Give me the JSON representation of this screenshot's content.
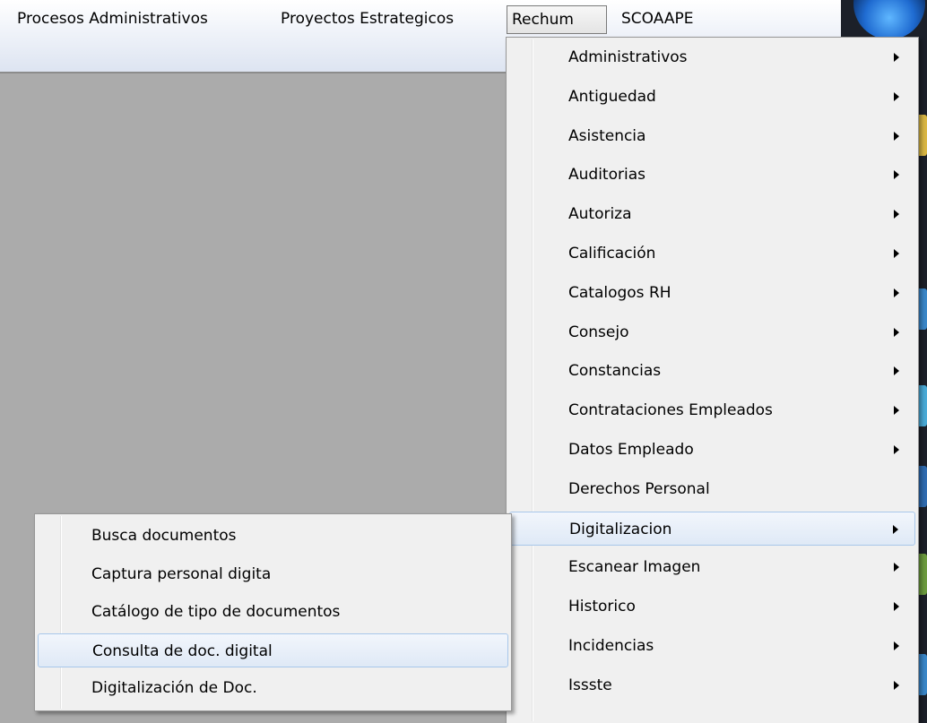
{
  "menubar": {
    "items": [
      {
        "label": "Procesos Administrativos"
      },
      {
        "label": "Proyectos Estrategicos"
      },
      {
        "label": "Rechum",
        "active": true
      },
      {
        "label": "SCOAAPE"
      }
    ]
  },
  "rechum_menu": {
    "items": [
      {
        "label": "Administrativos",
        "submenu": true
      },
      {
        "label": "Antiguedad",
        "submenu": true
      },
      {
        "label": "Asistencia",
        "submenu": true
      },
      {
        "label": "Auditorias",
        "submenu": true
      },
      {
        "label": "Autoriza",
        "submenu": true
      },
      {
        "label": "Calificación",
        "submenu": true
      },
      {
        "label": "Catalogos RH",
        "submenu": true
      },
      {
        "label": "Consejo",
        "submenu": true
      },
      {
        "label": "Constancias",
        "submenu": true
      },
      {
        "label": "Contrataciones Empleados",
        "submenu": true
      },
      {
        "label": "Datos Empleado",
        "submenu": true
      },
      {
        "label": "Derechos Personal",
        "submenu": false
      },
      {
        "label": "Digitalizacion",
        "submenu": true,
        "highlighted": true
      },
      {
        "label": "Escanear Imagen",
        "submenu": true
      },
      {
        "label": "Historico",
        "submenu": true
      },
      {
        "label": "Incidencias",
        "submenu": true
      },
      {
        "label": "Issste",
        "submenu": true
      }
    ]
  },
  "digitalizacion_menu": {
    "items": [
      {
        "label": "Busca documentos"
      },
      {
        "label": "Captura personal digita"
      },
      {
        "label": "Catálogo de tipo de documentos"
      },
      {
        "label": "Consulta de doc. digital",
        "highlighted": true
      },
      {
        "label": "Digitalización de Doc."
      }
    ]
  },
  "colors": {
    "background": "#ababab",
    "menu_bg": "#f0f0f0",
    "highlight_border": "#a8c7ea"
  }
}
